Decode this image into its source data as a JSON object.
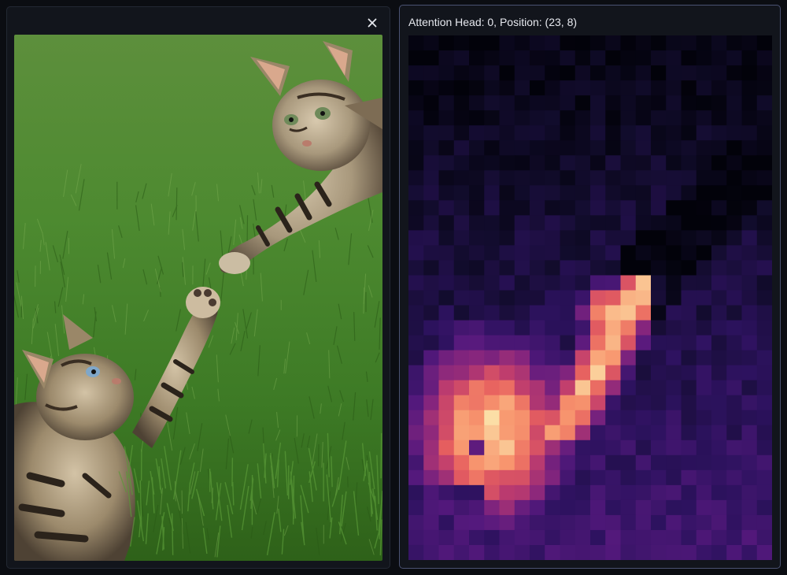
{
  "image_panel": {
    "close_icon": "close-icon",
    "image_description_colors": {
      "grass": "#3f7f2c",
      "fur_light": "#c8b69a",
      "fur_dark": "#3a3128"
    }
  },
  "attention_panel": {
    "title": "Attention Head: 0, Position: (23, 8)",
    "head": 0,
    "position": [
      23,
      8
    ],
    "colormap": "magma",
    "grid_cols": 24,
    "grid_rows": 35
  },
  "colors": {
    "page_bg": "#0b0d12",
    "panel_bg": "#12151c",
    "panel_border": "#232833",
    "active_border": "#4a5272",
    "text": "#e6e8ee"
  }
}
